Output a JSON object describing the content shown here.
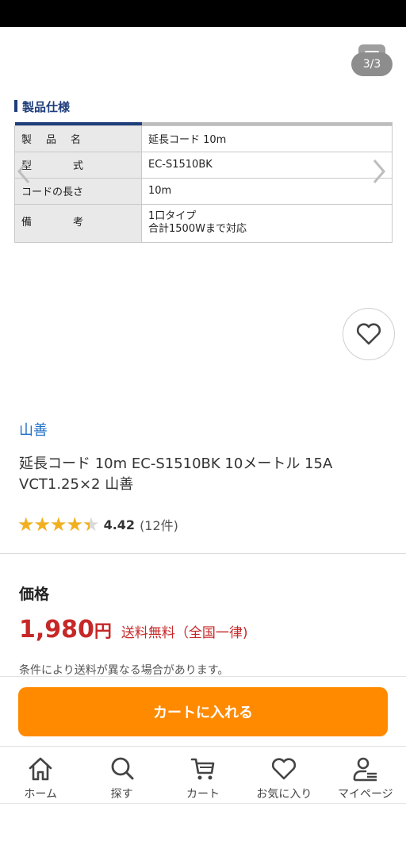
{
  "gallery": {
    "counter": "3/3",
    "icons": {
      "image": "image-icon",
      "prev": "chevron-left-icon",
      "next": "chevron-right-icon",
      "favorite": "heart-icon"
    }
  },
  "spec": {
    "heading": "製品仕様",
    "rows": [
      {
        "label": "製品名",
        "value": "延長コード 10m"
      },
      {
        "label": "型式",
        "value": "EC-S1510BK"
      },
      {
        "label": "コードの長さ",
        "value": "10m"
      },
      {
        "label": "備考",
        "value_line1": "1口タイプ",
        "value_line2": "合計1500Wまで対応"
      }
    ]
  },
  "product": {
    "brand": "山善",
    "title": "延長コード 10m EC-S1510BK 10メートル 15A VCT1.25×2 山善",
    "rating": {
      "stars": "★★★★★",
      "value": "4.42",
      "value_fraction": 0.884,
      "count": "(12件)"
    }
  },
  "price": {
    "label": "価格",
    "amount": "1,980",
    "currency": "円",
    "shipping": "送料無料（全国一律)",
    "note": "条件により送料が異なる場合があります。"
  },
  "cart": {
    "button_label": "カートに入れる"
  },
  "bottom_nav": {
    "items": [
      {
        "label": "ホーム",
        "icon": "home-icon"
      },
      {
        "label": "探す",
        "icon": "search-icon"
      },
      {
        "label": "カート",
        "icon": "cart-icon"
      },
      {
        "label": "お気に入り",
        "icon": "heart-icon"
      },
      {
        "label": "マイページ",
        "icon": "user-icon"
      }
    ]
  },
  "colors": {
    "accent": "#ff8a00",
    "price": "#c62828",
    "brand_link": "#1f6fc4",
    "spec_heading": "#1e3d7b",
    "star": "#f2b01e"
  }
}
